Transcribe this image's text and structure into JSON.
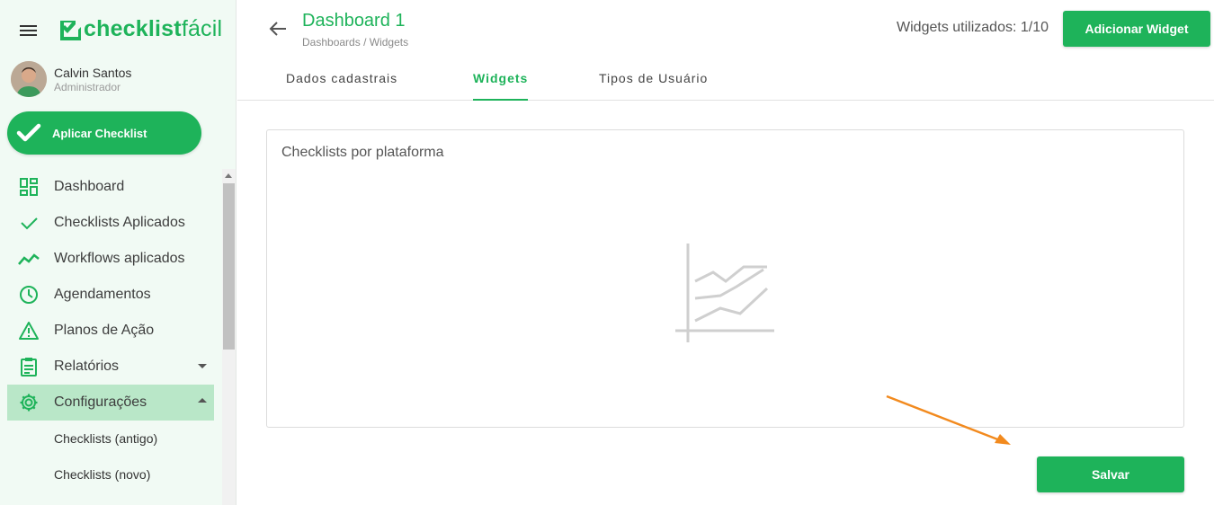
{
  "brand": {
    "logo_text_bold": "checklist",
    "logo_text_light": "fácil",
    "color": "#1eb35a"
  },
  "user": {
    "name": "Calvin Santos",
    "role": "Administrador"
  },
  "sidebar": {
    "apply_button": "Aplicar Checklist",
    "items": [
      {
        "label": "Dashboard",
        "icon": "dashboard-icon"
      },
      {
        "label": "Checklists Aplicados",
        "icon": "check-icon"
      },
      {
        "label": "Workflows aplicados",
        "icon": "trending-icon"
      },
      {
        "label": "Agendamentos",
        "icon": "clock-icon"
      },
      {
        "label": "Planos de Ação",
        "icon": "warning-icon"
      },
      {
        "label": "Relatórios",
        "icon": "clipboard-icon"
      },
      {
        "label": "Configurações",
        "icon": "gear-icon"
      }
    ],
    "sub_items": [
      {
        "label": "Checklists (antigo)"
      },
      {
        "label": "Checklists (novo)"
      }
    ]
  },
  "header": {
    "title": "Dashboard 1",
    "breadcrumb_parent": "Dashboards",
    "breadcrumb_sep": "/",
    "breadcrumb_current": "Widgets",
    "widgets_used": "Widgets utilizados: 1/10",
    "add_button": "Adicionar Widget"
  },
  "tabs": [
    {
      "label": "Dados cadastrais"
    },
    {
      "label": "Widgets"
    },
    {
      "label": "Tipos de Usuário"
    }
  ],
  "widget": {
    "title": "Checklists por plataforma",
    "icon": "line-chart-placeholder-icon"
  },
  "footer": {
    "save_button": "Salvar"
  },
  "annotation": {
    "arrow_color": "#f28a1e"
  }
}
